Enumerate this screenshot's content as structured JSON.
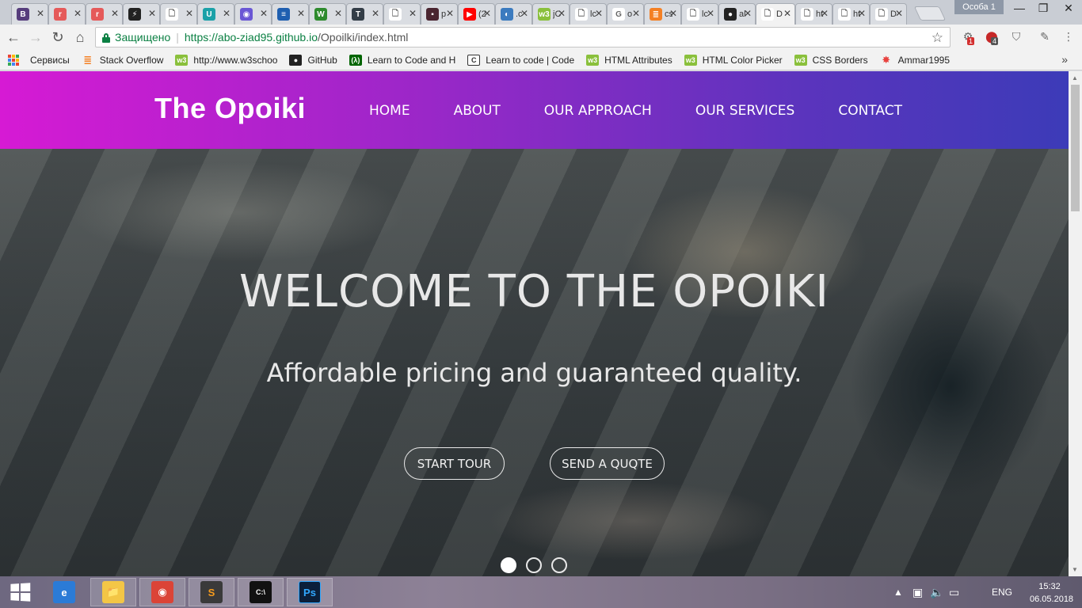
{
  "browser": {
    "tabs": [
      {
        "title": "",
        "icon": "bootstrap-icon",
        "color": "#563d7c",
        "glyph": "B"
      },
      {
        "title": "",
        "icon": "r-icon",
        "color": "#e55a5a",
        "glyph": "r"
      },
      {
        "title": "",
        "icon": "r-icon",
        "color": "#e55a5a",
        "glyph": "r"
      },
      {
        "title": "",
        "icon": "lightning-icon",
        "color": "#222222",
        "glyph": "⚡"
      },
      {
        "title": "",
        "icon": "document-icon",
        "color": "#ffffff",
        "glyph": "🗋"
      },
      {
        "title": "",
        "icon": "uc-icon",
        "color": "#1ba1a8",
        "glyph": "U"
      },
      {
        "title": "",
        "icon": "stackblitz-icon",
        "color": "#6a57d5",
        "glyph": "◉"
      },
      {
        "title": "",
        "icon": "stack-icon",
        "color": "#1f5fb0",
        "glyph": "≡"
      },
      {
        "title": "",
        "icon": "w-icon",
        "color": "#2e8b2e",
        "glyph": "W"
      },
      {
        "title": "",
        "icon": "t-icon",
        "color": "#333d47",
        "glyph": "T"
      },
      {
        "title": "",
        "icon": "document-icon",
        "color": "#ffffff",
        "glyph": "🗋"
      },
      {
        "title": "p",
        "icon": "photo-icon",
        "color": "#4a2530",
        "glyph": "▪"
      },
      {
        "title": "(2",
        "icon": "youtube-icon",
        "color": "#ff0000",
        "glyph": "▶"
      },
      {
        "title": ".c",
        "icon": "c-icon",
        "color": "#3b7bbf",
        "glyph": "◐"
      },
      {
        "title": "jC",
        "icon": "w3-icon",
        "color": "#8ac03c",
        "glyph": "w3"
      },
      {
        "title": "lc",
        "icon": "document-icon",
        "color": "#ffffff",
        "glyph": "🗋"
      },
      {
        "title": "o",
        "icon": "google-icon",
        "color": "#ffffff",
        "glyph": "G"
      },
      {
        "title": "cs",
        "icon": "stackoverflow-icon",
        "color": "#f48024",
        "glyph": "≣"
      },
      {
        "title": "lc",
        "icon": "document-icon",
        "color": "#ffffff",
        "glyph": "🗋"
      },
      {
        "title": "al",
        "icon": "github-icon",
        "color": "#222222",
        "glyph": "●"
      },
      {
        "title": "D",
        "icon": "document-icon",
        "color": "#ffffff",
        "glyph": "🗋",
        "active": true
      },
      {
        "title": "ht",
        "icon": "document-icon",
        "color": "#ffffff",
        "glyph": "🗋"
      },
      {
        "title": "ht",
        "icon": "document-icon",
        "color": "#ffffff",
        "glyph": "🗋"
      },
      {
        "title": "D",
        "icon": "document-icon",
        "color": "#ffffff",
        "glyph": "🗋"
      }
    ],
    "profile": "Особа 1",
    "security_label": "Защищено",
    "url_host": "https://abo-ziad95.github.io",
    "url_path": "/Opoilki/index.html",
    "ext_badges": [
      "1",
      "4"
    ],
    "bookmarks": [
      {
        "label": "Сервисы",
        "icon": "apps-icon"
      },
      {
        "label": "Stack Overflow",
        "icon": "stackoverflow-icon",
        "color": "#f48024",
        "glyph": "≣"
      },
      {
        "label": "http://www.w3schoo",
        "icon": "w3-icon",
        "color": "#8ac03c",
        "glyph": "w3"
      },
      {
        "label": "GitHub",
        "icon": "github-icon",
        "color": "#222222",
        "glyph": "●"
      },
      {
        "label": "Learn to Code and H",
        "icon": "freecodecamp-icon",
        "color": "#006400",
        "glyph": "(λ)"
      },
      {
        "label": "Learn to code | Code",
        "icon": "codecademy-icon",
        "color": "#ffffff",
        "glyph": "C"
      },
      {
        "label": "HTML Attributes",
        "icon": "w3-icon",
        "color": "#8ac03c",
        "glyph": "w3"
      },
      {
        "label": "HTML Color Picker",
        "icon": "w3-icon",
        "color": "#8ac03c",
        "glyph": "w3"
      },
      {
        "label": "CSS Borders",
        "icon": "w3-icon",
        "color": "#8ac03c",
        "glyph": "w3"
      },
      {
        "label": "Ammar1995",
        "icon": "pinwheel-icon",
        "color": "#e8423f",
        "glyph": "✸"
      }
    ]
  },
  "site": {
    "brand": "The Opoiki",
    "menu": [
      "HOME",
      "ABOUT",
      "OUR APPROACH",
      "OUR SERVICES",
      "CONTACT"
    ],
    "hero_title": "WELCOME TO THE OPOIKI",
    "hero_subtitle": "Affordable pricing and guaranteed quality.",
    "btn_tour": "START TOUR",
    "btn_quote": "SEND A QUQTE",
    "slides": 3,
    "active_slide": 1
  },
  "taskbar": {
    "language": "ENG",
    "time": "15:32",
    "date": "06.05.2018",
    "apps": [
      {
        "name": "ie-icon",
        "glyph": "e",
        "bg": "#2b7bd6",
        "open": false
      },
      {
        "name": "explorer-icon",
        "glyph": "📁",
        "bg": "#f3c646",
        "open": true
      },
      {
        "name": "chrome-icon",
        "glyph": "◉",
        "bg": "#db4437",
        "open": true
      },
      {
        "name": "sublime-icon",
        "glyph": "S",
        "bg": "#3a3a3a",
        "open": true
      },
      {
        "name": "cmd-icon",
        "glyph": "C:\\",
        "bg": "#111111",
        "open": true
      },
      {
        "name": "photoshop-icon",
        "glyph": "Ps",
        "bg": "#0b1f3a",
        "open": true
      }
    ]
  }
}
